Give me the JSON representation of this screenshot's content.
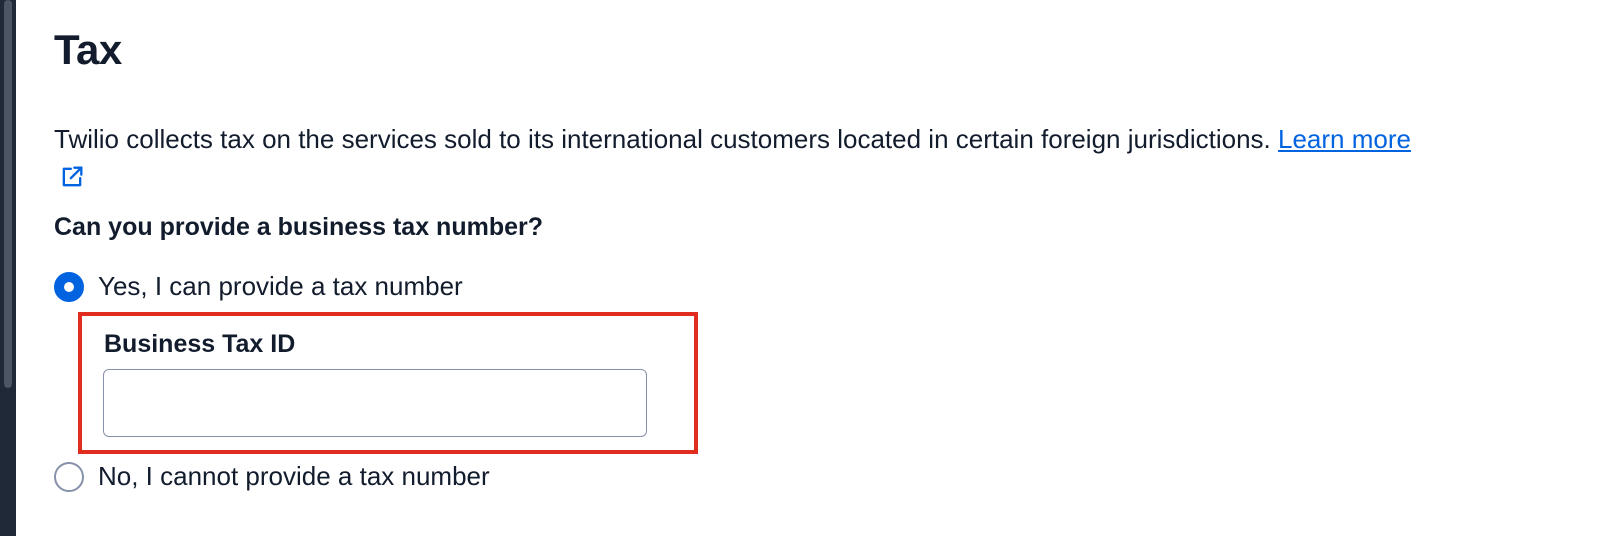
{
  "page": {
    "title": "Tax",
    "description": "Twilio collects tax on the services sold to its international customers located in certain foreign jurisdictions. ",
    "learn_more_label": "Learn more",
    "learn_more_icon": "external-link-icon"
  },
  "form": {
    "question": "Can you provide a business tax number?",
    "options": [
      {
        "label": "Yes, I can provide a tax number",
        "selected": true
      },
      {
        "label": "No, I cannot provide a tax number",
        "selected": false
      }
    ],
    "tax_id": {
      "label": "Business Tax ID",
      "value": "",
      "placeholder": ""
    }
  },
  "colors": {
    "accent": "#0263e0",
    "highlight": "#e02d1f",
    "text": "#121c2d"
  }
}
